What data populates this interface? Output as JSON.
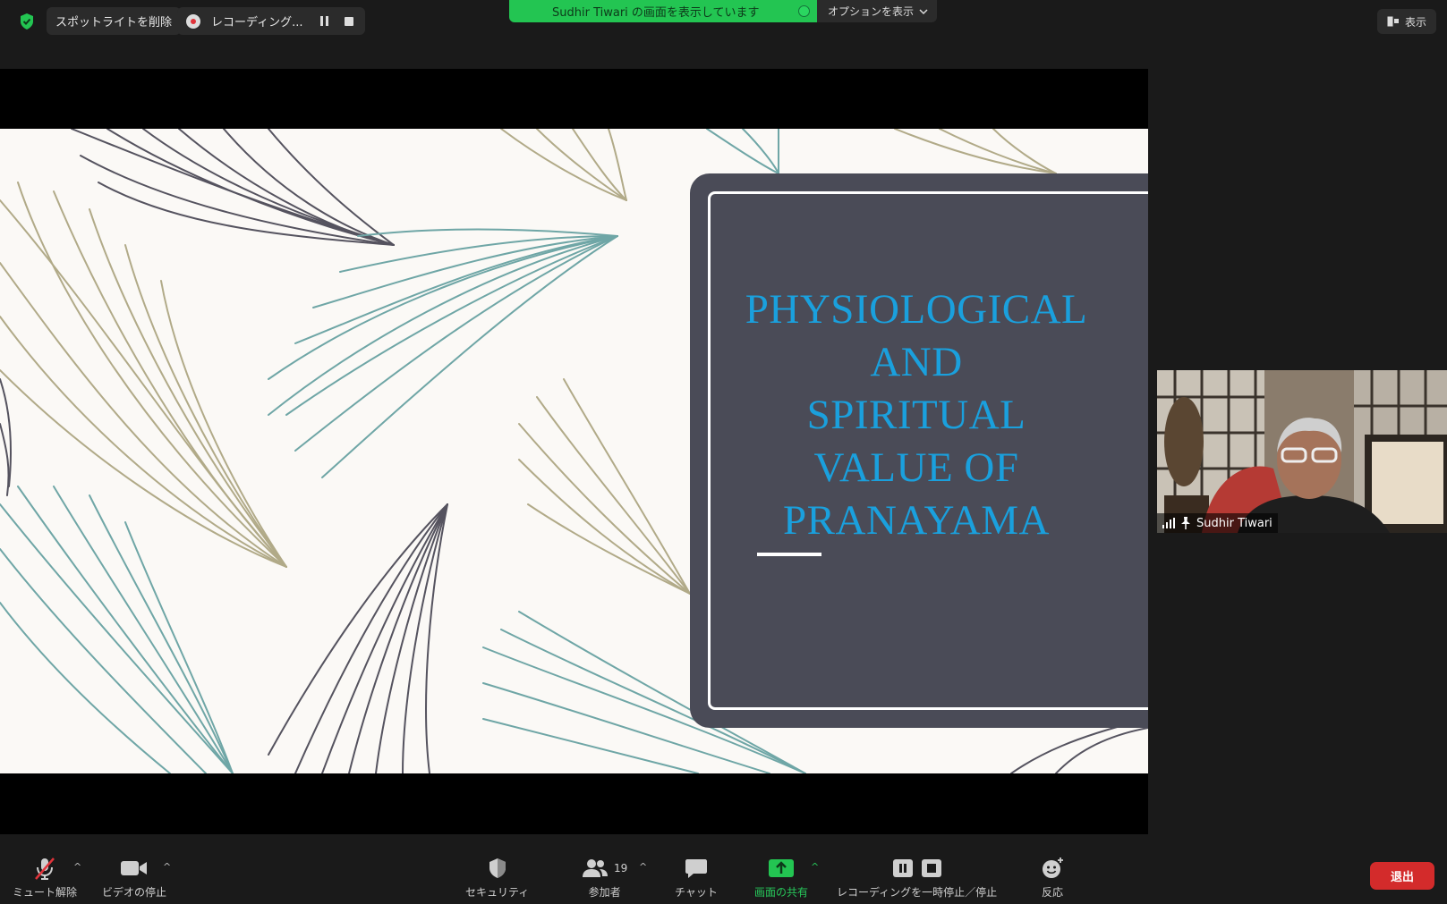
{
  "topbar": {
    "spotlight_label": "スポットライトを削除",
    "recording_label": "レコーディング...",
    "share_banner": "Sudhir Tiwari の画面を表示しています",
    "options_label": "オプションを表示",
    "view_label": "表示"
  },
  "slide": {
    "title_lines": [
      "PHYSIOLOGICAL",
      "AND",
      "SPIRITUAL",
      "VALUE OF",
      "PRANAYAMA"
    ],
    "title_color": "#1aa0dd",
    "panel_color": "#4a4b57"
  },
  "participant": {
    "name": "Sudhir Tiwari"
  },
  "toolbar": {
    "unmute": "ミュート解除",
    "stop_video": "ビデオの停止",
    "security": "セキュリティ",
    "participants": "参加者",
    "participant_count": "19",
    "chat": "チャット",
    "share_screen": "画面の共有",
    "recording": "レコーディングを一時停止／停止",
    "reactions": "反応",
    "leave": "退出"
  },
  "colors": {
    "share_green": "#23c552",
    "leave_red": "#d32b2b"
  }
}
